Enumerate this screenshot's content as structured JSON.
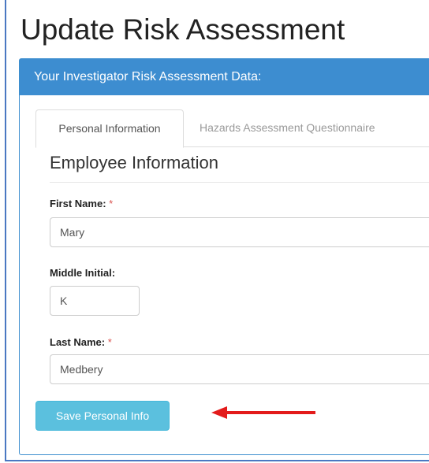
{
  "page": {
    "title": "Update Risk Assessment"
  },
  "panel": {
    "heading": "Your Investigator Risk Assessment Data:"
  },
  "tabs": [
    {
      "label": "Personal Information",
      "active": true
    },
    {
      "label": "Hazards Assessment Questionnaire",
      "active": false
    }
  ],
  "section": {
    "title": "Employee Information"
  },
  "form": {
    "first_name": {
      "label": "First Name:",
      "required_mark": "*",
      "value": "Mary"
    },
    "middle_initial": {
      "label": "Middle Initial:",
      "value": "K"
    },
    "last_name": {
      "label": "Last Name:",
      "required_mark": "*",
      "value": "Medbery"
    }
  },
  "actions": {
    "save_label": "Save Personal Info"
  },
  "annotation": {
    "icon": "red-arrow-icon",
    "color": "#e31b1b"
  },
  "colors": {
    "panel_heading": "#3d8dd0",
    "save_button": "#5bc0de",
    "required": "#d9534f"
  }
}
